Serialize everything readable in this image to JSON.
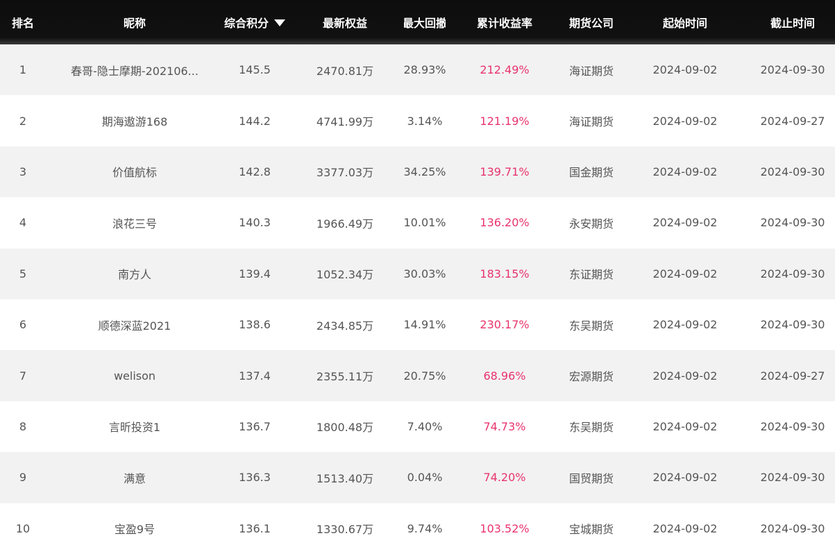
{
  "header": {
    "rank": "排名",
    "name": "昵称",
    "score": "综合积分",
    "equity": "最新权益",
    "max_drawdown": "最大回撤",
    "cum_return": "累计收益率",
    "broker": "期货公司",
    "start": "起始时间",
    "end": "截止时间",
    "sort_icon": "caret-down"
  },
  "colors": {
    "header_bg": "#111111",
    "return_text": "#e8336d",
    "row_alt_bg": "#f2f2f2",
    "body_text": "#555555"
  },
  "rows": [
    {
      "rank": "1",
      "name": "春哥-隐士摩期-202106...",
      "score": "145.5",
      "equity": "2470.81万",
      "max_drawdown": "28.93%",
      "cum_return": "212.49%",
      "broker": "海证期货",
      "start": "2024-09-02",
      "end": "2024-09-30"
    },
    {
      "rank": "2",
      "name": "期海遨游168",
      "score": "144.2",
      "equity": "4741.99万",
      "max_drawdown": "3.14%",
      "cum_return": "121.19%",
      "broker": "海证期货",
      "start": "2024-09-02",
      "end": "2024-09-27"
    },
    {
      "rank": "3",
      "name": "价值航标",
      "score": "142.8",
      "equity": "3377.03万",
      "max_drawdown": "34.25%",
      "cum_return": "139.71%",
      "broker": "国金期货",
      "start": "2024-09-02",
      "end": "2024-09-30"
    },
    {
      "rank": "4",
      "name": "浪花三号",
      "score": "140.3",
      "equity": "1966.49万",
      "max_drawdown": "10.01%",
      "cum_return": "136.20%",
      "broker": "永安期货",
      "start": "2024-09-02",
      "end": "2024-09-30"
    },
    {
      "rank": "5",
      "name": "南方人",
      "score": "139.4",
      "equity": "1052.34万",
      "max_drawdown": "30.03%",
      "cum_return": "183.15%",
      "broker": "东证期货",
      "start": "2024-09-02",
      "end": "2024-09-30"
    },
    {
      "rank": "6",
      "name": "顺德深蓝2021",
      "score": "138.6",
      "equity": "2434.85万",
      "max_drawdown": "14.91%",
      "cum_return": "230.17%",
      "broker": "东吴期货",
      "start": "2024-09-02",
      "end": "2024-09-30"
    },
    {
      "rank": "7",
      "name": "welison",
      "score": "137.4",
      "equity": "2355.11万",
      "max_drawdown": "20.75%",
      "cum_return": "68.96%",
      "broker": "宏源期货",
      "start": "2024-09-02",
      "end": "2024-09-27"
    },
    {
      "rank": "8",
      "name": "言昕投资1",
      "score": "136.7",
      "equity": "1800.48万",
      "max_drawdown": "7.40%",
      "cum_return": "74.73%",
      "broker": "东吴期货",
      "start": "2024-09-02",
      "end": "2024-09-30"
    },
    {
      "rank": "9",
      "name": "满意",
      "score": "136.3",
      "equity": "1513.40万",
      "max_drawdown": "0.04%",
      "cum_return": "74.20%",
      "broker": "国贸期货",
      "start": "2024-09-02",
      "end": "2024-09-30"
    },
    {
      "rank": "10",
      "name": "宝盈9号",
      "score": "136.1",
      "equity": "1330.67万",
      "max_drawdown": "9.74%",
      "cum_return": "103.52%",
      "broker": "宝城期货",
      "start": "2024-09-02",
      "end": "2024-09-30"
    }
  ]
}
